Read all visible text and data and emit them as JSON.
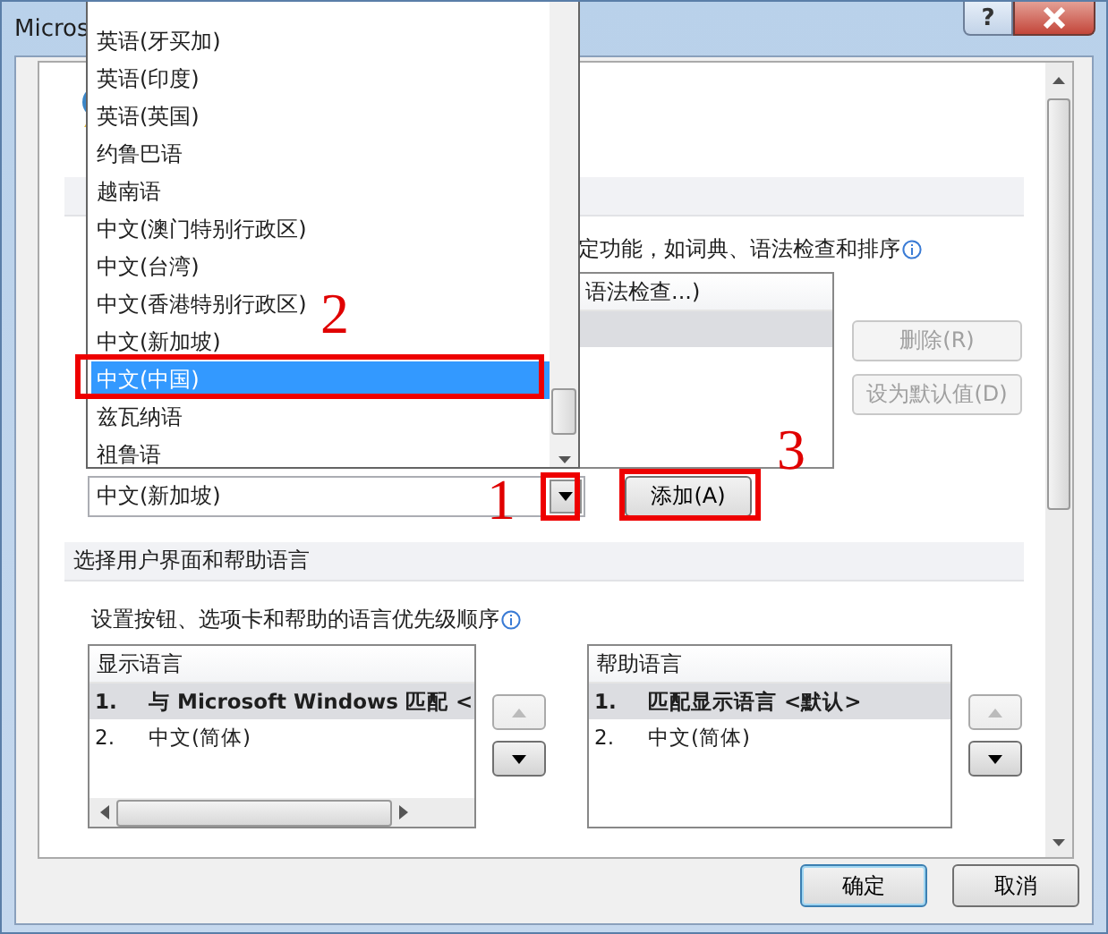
{
  "window": {
    "title": "Micros",
    "help_button": "?"
  },
  "editing_section": {
    "description": "定功能，如词典、语法检查和排序",
    "list": {
      "header": "语法检查...)",
      "rows": [
        {
          "selected": true
        }
      ]
    },
    "remove_button": {
      "label": "删除(R)",
      "disabled": true
    },
    "default_button": {
      "label": "设为默认值(D)",
      "disabled": true
    },
    "combo": {
      "value": "中文(新加坡)"
    },
    "add_button": {
      "label": "添加(A)"
    }
  },
  "ui_section": {
    "header": "选择用户界面和帮助语言",
    "description": "设置按钮、选项卡和帮助的语言优先级顺序",
    "lists": [
      {
        "header": "显示语言",
        "rows": [
          {
            "index": "1.",
            "label": "与 Microsoft Windows 匹配 <",
            "selected": true
          },
          {
            "index": "2.",
            "label": "中文(简体)",
            "selected": false
          }
        ],
        "hscroll": true
      },
      {
        "header": "帮助语言",
        "rows": [
          {
            "index": "1.",
            "label": "匹配显示语言 <默认>",
            "selected": true
          },
          {
            "index": "2.",
            "label": "中文(简体)",
            "selected": false
          }
        ],
        "hscroll": false
      }
    ]
  },
  "dropdown": {
    "items": [
      {
        "label": "英语(牙买加)",
        "selected": false
      },
      {
        "label": "英语(印度)",
        "selected": false
      },
      {
        "label": "英语(英国)",
        "selected": false
      },
      {
        "label": "约鲁巴语",
        "selected": false
      },
      {
        "label": "越南语",
        "selected": false
      },
      {
        "label": "中文(澳门特别行政区)",
        "selected": false
      },
      {
        "label": "中文(台湾)",
        "selected": false
      },
      {
        "label": "中文(香港特别行政区)",
        "selected": false
      },
      {
        "label": "中文(新加坡)",
        "selected": false
      },
      {
        "label": "中文(中国)",
        "selected": true
      },
      {
        "label": "兹瓦纳语",
        "selected": false
      },
      {
        "label": "祖鲁语",
        "selected": false
      }
    ]
  },
  "dialog_buttons": [
    {
      "label": "确定",
      "kind": "primary"
    },
    {
      "label": "取消",
      "kind": "normal"
    }
  ],
  "annotations": [
    {
      "label": "1"
    },
    {
      "label": "2"
    },
    {
      "label": "3"
    }
  ]
}
